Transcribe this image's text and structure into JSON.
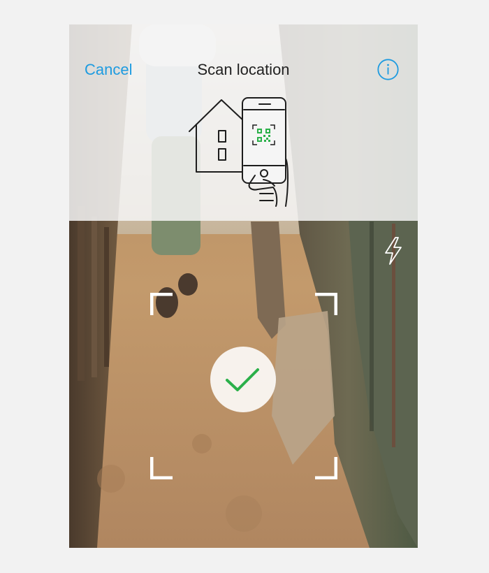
{
  "header": {
    "cancel_label": "Cancel",
    "title": "Scan location",
    "info_icon": "info-circle-icon"
  },
  "illustration": {
    "description_icon": "house-phone-qr-icon"
  },
  "camera": {
    "flash_icon": "flash-icon",
    "scan_result_icon": "checkmark-icon"
  },
  "colors": {
    "accent": "#1e9be0",
    "success": "#2bb04a",
    "overlay": "#f5f5f5"
  }
}
